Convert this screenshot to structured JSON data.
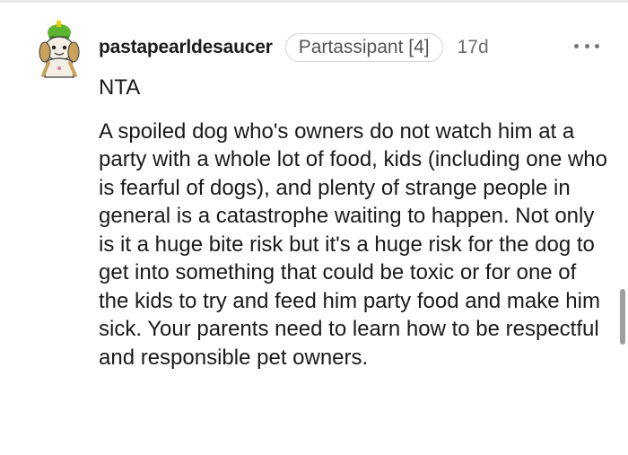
{
  "comment": {
    "author": "pastapearldesaucer",
    "flair": "Partassipant [4]",
    "age": "17d",
    "avatar_icon": "snoo-avatar-icon",
    "more_icon": "more-options-icon",
    "paragraphs": [
      "NTA",
      "A spoiled dog who's owners do not watch him at a party with a whole lot of food, kids (including one who is fearful of dogs), and plenty of strange people in general is a catastrophe waiting to happen. Not only is it a huge bite risk but it's a huge risk for the dog to get into something that could be toxic or for one of the kids to try and feed him party food and make him sick. Your parents need to learn how to be respectful and responsible pet owners."
    ]
  },
  "colors": {
    "username": "#1c1c1c",
    "meta": "#6f6f6f",
    "flair_border": "#d6d6d6",
    "body": "#1a1a1b",
    "scrollbar": "#9e9e9e"
  }
}
